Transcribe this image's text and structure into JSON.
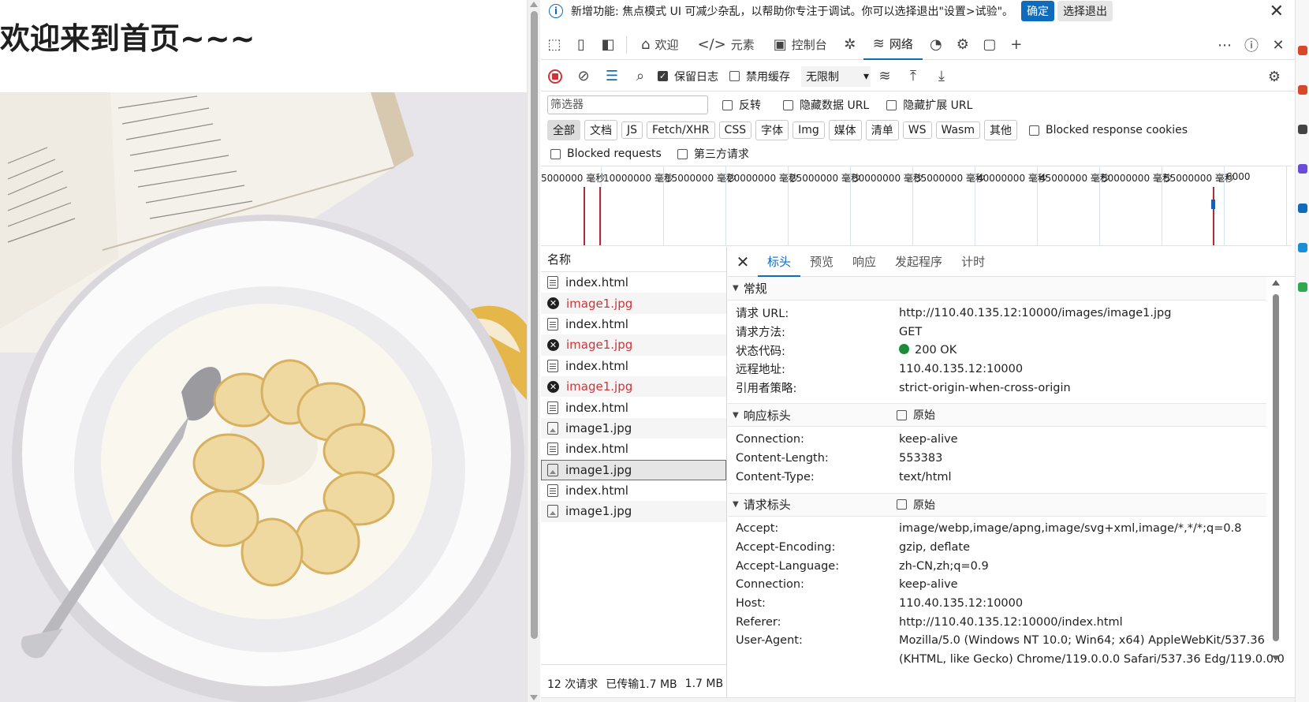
{
  "page": {
    "heading": "欢迎来到首页~~~",
    "photo_alt": "image1.jpg"
  },
  "banner": {
    "message": "新增功能: 焦点模式 UI 可减少杂乱，以帮助你专注于调试。你可以选择退出\"设置>试验\"。",
    "confirm": "确定",
    "optout": "选择退出"
  },
  "tabs": [
    {
      "label": "欢迎",
      "icon": "home-icon"
    },
    {
      "label": "元素",
      "icon": "code-icon"
    },
    {
      "label": "控制台",
      "icon": "console-icon"
    },
    {
      "label": "网络",
      "icon": "wifi-icon",
      "active": true
    }
  ],
  "toolbar": {
    "preserve_log": "保留日志",
    "disable_cache": "禁用缓存",
    "throttle": "无限制"
  },
  "filter": {
    "placeholder": "筛选器",
    "invert": "反转",
    "hide_data_url": "隐藏数据 URL",
    "hide_ext_url": "隐藏扩展 URL",
    "types": [
      "全部",
      "文档",
      "JS",
      "Fetch/XHR",
      "CSS",
      "字体",
      "Img",
      "媒体",
      "清单",
      "WS",
      "Wasm",
      "其他"
    ],
    "blocked_cookies": "Blocked response cookies",
    "blocked_requests": "Blocked requests",
    "third_party": "第三方请求"
  },
  "overview": {
    "labels": [
      "5000000 毫秒",
      "10000000 毫秒",
      "15000000 毫秒",
      "20000000 毫秒",
      "25000000 毫秒",
      "30000000 毫秒",
      "35000000 毫秒",
      "40000000 毫秒",
      "45000000 毫秒",
      "50000000 毫秒",
      "55000000 毫秒",
      "6000"
    ]
  },
  "requests": {
    "header": "名称",
    "rows": [
      {
        "name": "index.html",
        "kind": "doc",
        "error": false
      },
      {
        "name": "image1.jpg",
        "kind": "img",
        "error": true
      },
      {
        "name": "index.html",
        "kind": "doc",
        "error": false
      },
      {
        "name": "image1.jpg",
        "kind": "img",
        "error": true
      },
      {
        "name": "index.html",
        "kind": "doc",
        "error": false
      },
      {
        "name": "image1.jpg",
        "kind": "img",
        "error": true
      },
      {
        "name": "index.html",
        "kind": "doc",
        "error": false
      },
      {
        "name": "image1.jpg",
        "kind": "img",
        "error": false
      },
      {
        "name": "index.html",
        "kind": "doc",
        "error": false
      },
      {
        "name": "image1.jpg",
        "kind": "img",
        "error": false,
        "selected": true
      },
      {
        "name": "index.html",
        "kind": "doc",
        "error": false
      },
      {
        "name": "image1.jpg",
        "kind": "img",
        "error": false
      }
    ],
    "footer": {
      "count": "12 次请求",
      "transferred": "已传输1.7 MB",
      "size": "1.7 MB"
    }
  },
  "detail": {
    "tabs": [
      "标头",
      "预览",
      "响应",
      "发起程序",
      "计时"
    ],
    "general": {
      "title": "常规",
      "rows": [
        {
          "k": "请求 URL:",
          "v": "http://110.40.135.12:10000/images/image1.jpg"
        },
        {
          "k": "请求方法:",
          "v": "GET"
        },
        {
          "k": "状态代码:",
          "v": "200 OK"
        },
        {
          "k": "远程地址:",
          "v": "110.40.135.12:10000"
        },
        {
          "k": "引用者策略:",
          "v": "strict-origin-when-cross-origin"
        }
      ]
    },
    "response": {
      "title": "响应标头",
      "raw": "原始",
      "rows": [
        {
          "k": "Connection:",
          "v": "keep-alive"
        },
        {
          "k": "Content-Length:",
          "v": "553383"
        },
        {
          "k": "Content-Type:",
          "v": "text/html"
        }
      ]
    },
    "request": {
      "title": "请求标头",
      "raw": "原始",
      "rows": [
        {
          "k": "Accept:",
          "v": "image/webp,image/apng,image/svg+xml,image/*,*/*;q=0.8"
        },
        {
          "k": "Accept-Encoding:",
          "v": "gzip, deflate"
        },
        {
          "k": "Accept-Language:",
          "v": "zh-CN,zh;q=0.9"
        },
        {
          "k": "Connection:",
          "v": "keep-alive"
        },
        {
          "k": "Host:",
          "v": "110.40.135.12:10000"
        },
        {
          "k": "Referer:",
          "v": "http://110.40.135.12:10000/index.html"
        },
        {
          "k": "User-Agent:",
          "v": "Mozilla/5.0 (Windows NT 10.0; Win64; x64) AppleWebKit/537.36"
        },
        {
          "k": "",
          "v": "(KHTML, like Gecko) Chrome/119.0.0.0 Safari/537.36 Edg/119.0.0.0"
        }
      ]
    }
  },
  "colors": {
    "accent": "#0f6cbd",
    "error": "#d13438",
    "ok": "#1e8a3c"
  }
}
